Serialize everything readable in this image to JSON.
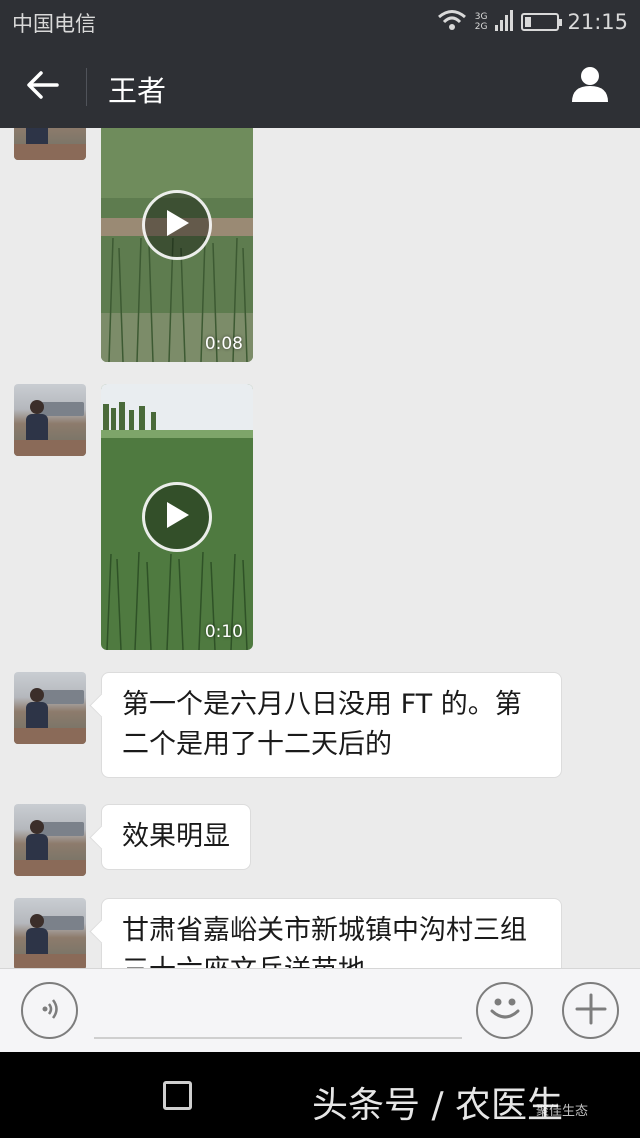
{
  "status_bar": {
    "carrier": "中国电信",
    "network_top": "3G",
    "network_bottom": "2G",
    "battery_level": 0.2,
    "time": "21:15"
  },
  "header": {
    "title": "王者",
    "back_icon": "arrow-left-icon",
    "profile_icon": "person-icon"
  },
  "messages": [
    {
      "type": "video",
      "duration": "0:08"
    },
    {
      "type": "video",
      "duration": "0:10"
    },
    {
      "type": "text",
      "text_line1": "第一个是六月八日没用 FT 的。第",
      "text_line2": "二个是用了十二天后的"
    },
    {
      "type": "text",
      "text": "效果明显"
    },
    {
      "type": "text",
      "text_line1": "甘肃省嘉峪关市新城镇中沟村三组",
      "text_line2": "三十六座文兵送苗地"
    }
  ],
  "input_bar": {
    "voice_icon": "voice-icon",
    "input_value": "",
    "emoji_icon": "smiley-icon",
    "plus_icon": "plus-icon"
  },
  "nav_bar": {
    "recents_icon": "square-icon",
    "watermark": "头条号 / 农医生",
    "watermark_small": "聚佳生态"
  },
  "colors": {
    "header_bg": "#2e3035",
    "chat_bg": "#ebebeb",
    "bubble_bg": "#ffffff"
  }
}
